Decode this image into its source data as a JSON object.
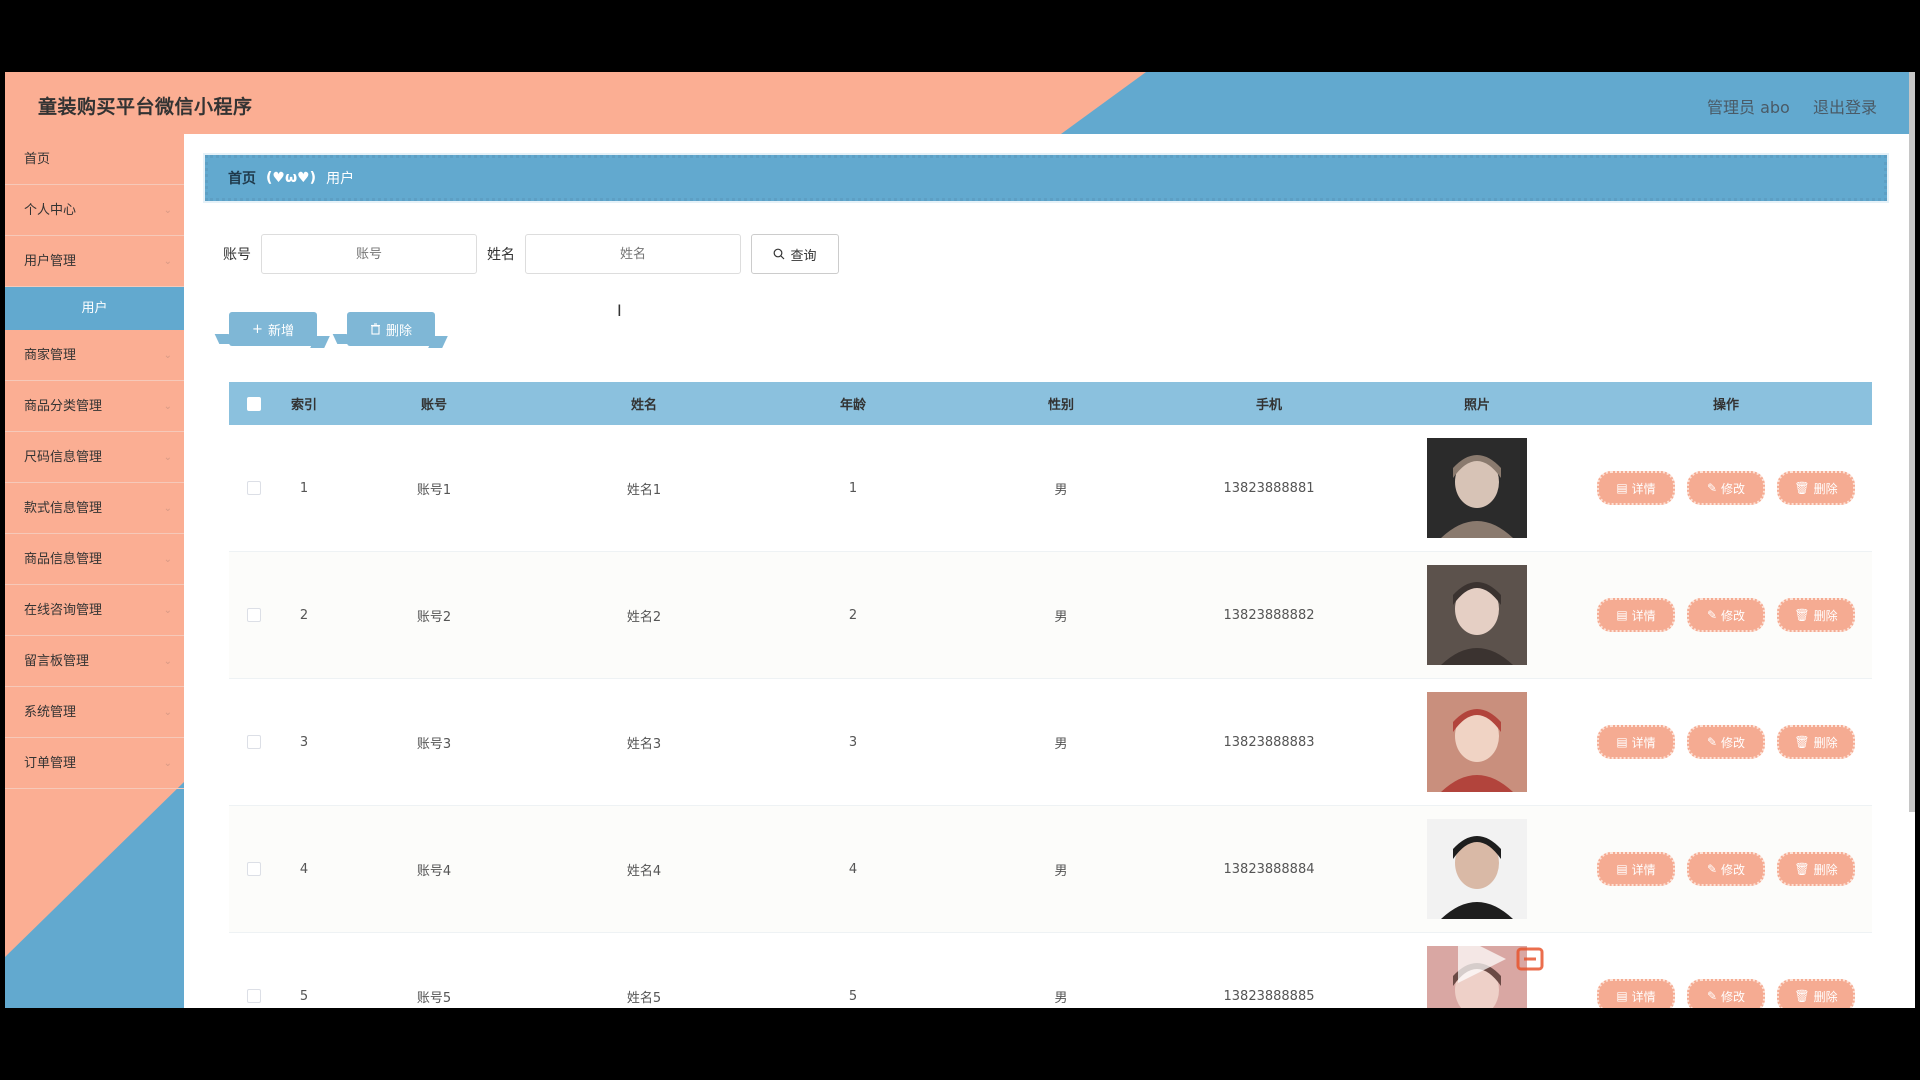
{
  "header": {
    "title": "童装购买平台微信小程序",
    "admin": "管理员 abo",
    "logout": "退出登录"
  },
  "sidebar": {
    "items": [
      {
        "label": "首页",
        "chevron": false
      },
      {
        "label": "个人中心",
        "chevron": true
      },
      {
        "label": "用户管理",
        "chevron": true
      },
      {
        "label": "用户",
        "sub": true
      },
      {
        "label": "商家管理",
        "chevron": true
      },
      {
        "label": "商品分类管理",
        "chevron": true
      },
      {
        "label": "尺码信息管理",
        "chevron": true
      },
      {
        "label": "款式信息管理",
        "chevron": true
      },
      {
        "label": "商品信息管理",
        "chevron": true
      },
      {
        "label": "在线咨询管理",
        "chevron": true
      },
      {
        "label": "留言板管理",
        "chevron": true
      },
      {
        "label": "系统管理",
        "chevron": true
      },
      {
        "label": "订单管理",
        "chevron": true
      }
    ]
  },
  "breadcrumb": {
    "home": "首页",
    "separator": "(♥ω♥)",
    "current": "用户"
  },
  "search": {
    "account_label": "账号",
    "account_placeholder": "账号",
    "name_label": "姓名",
    "name_placeholder": "姓名",
    "query_label": "查询"
  },
  "actions": {
    "add_label": "新增",
    "delete_label": "删除"
  },
  "table": {
    "columns": {
      "index": "索引",
      "account": "账号",
      "name": "姓名",
      "age": "年龄",
      "gender": "性别",
      "phone": "手机",
      "photo": "照片",
      "ops": "操作"
    },
    "ops": {
      "detail": "详情",
      "edit": "修改",
      "delete": "删除"
    },
    "rows": [
      {
        "index": "1",
        "account": "账号1",
        "name": "姓名1",
        "age": "1",
        "gender": "男",
        "phone": "13823888881"
      },
      {
        "index": "2",
        "account": "账号2",
        "name": "姓名2",
        "age": "2",
        "gender": "男",
        "phone": "13823888882"
      },
      {
        "index": "3",
        "account": "账号3",
        "name": "姓名3",
        "age": "3",
        "gender": "男",
        "phone": "13823888883"
      },
      {
        "index": "4",
        "account": "账号4",
        "name": "姓名4",
        "age": "4",
        "gender": "男",
        "phone": "13823888884"
      },
      {
        "index": "5",
        "account": "账号5",
        "name": "姓名5",
        "age": "5",
        "gender": "男",
        "phone": "13823888885"
      }
    ]
  },
  "colors": {
    "salmon": "#fbae93",
    "blue": "#62a9cf",
    "light_blue": "#8bc1de",
    "op_button": "#f5ab92"
  },
  "icons": {
    "search": "search-icon",
    "add": "plus-icon",
    "delete": "trash-icon",
    "detail": "document-icon",
    "edit": "pencil-icon",
    "chevron": "chevron-down-icon"
  }
}
